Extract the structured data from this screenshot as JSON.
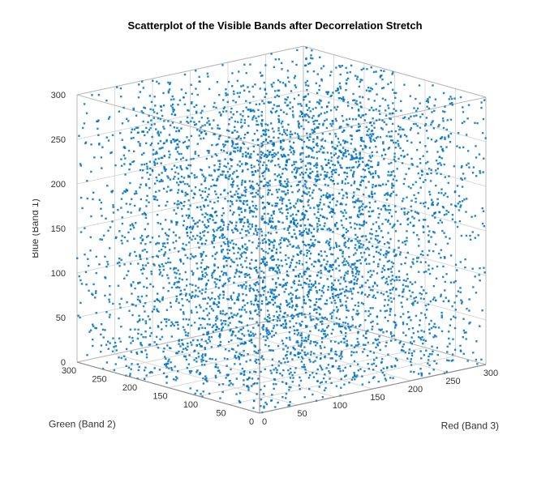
{
  "chart_data": {
    "type": "scatter",
    "title": "Scatterplot of the Visible Bands after Decorrelation Stretch",
    "axes": {
      "x": {
        "label": "Red (Band 3)",
        "ticks": [
          0,
          50,
          100,
          150,
          200,
          250,
          300
        ],
        "range": [
          0,
          300
        ]
      },
      "y": {
        "label": "Green (Band 2)",
        "ticks": [
          0,
          50,
          100,
          150,
          200,
          250,
          300
        ],
        "range": [
          0,
          300
        ]
      },
      "z": {
        "label": "Blue (Band 1)",
        "ticks": [
          0,
          50,
          100,
          150,
          200,
          250,
          300
        ],
        "range": [
          0,
          300
        ]
      }
    },
    "marker_color": "#0072BD",
    "point_count": 5000,
    "note": "Dense decorrelated 3D point cloud roughly uniformly filling the 0–300 cube with clustering near boundary planes; individual coordinates not discernible from image."
  }
}
